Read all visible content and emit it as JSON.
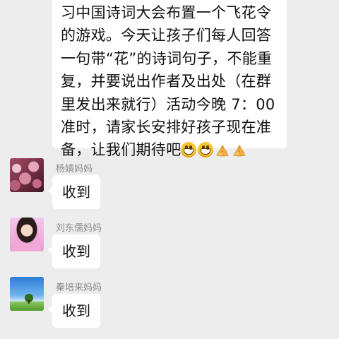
{
  "chat": {
    "first_message": {
      "text": "习中国诗词大会布置一个飞花令的游戏。今天让孩子们每人回答一句带“花”的诗词句子，不能重复，并要说出作者及出处（在群里发出来就行）活动今晚 7：00 准时，请家长安排好孩子现在准备，让我们期待吧",
      "emojis": [
        "grinning-face",
        "grinning-face",
        "folded-hands",
        "folded-hands"
      ]
    },
    "messages": [
      {
        "sender": "杨婧妈妈",
        "text": "收到",
        "avatar": "plum-blossom-photo"
      },
      {
        "sender": "刘东儒妈妈",
        "text": "收到",
        "avatar": "girl-portrait-photo"
      },
      {
        "sender": "秦培来妈妈",
        "text": "收到",
        "avatar": "blue-sky-meadow-photo"
      }
    ]
  }
}
